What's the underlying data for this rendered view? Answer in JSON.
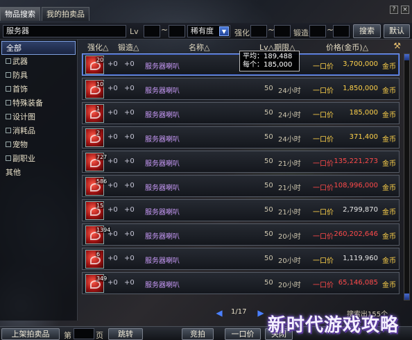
{
  "tabs": [
    {
      "label": "物品搜索"
    },
    {
      "label": "我的拍卖品"
    }
  ],
  "search": {
    "query": "服务器",
    "lv_label": "Lv",
    "tilde": "~",
    "rarity_label": "稀有度",
    "enhance_label": "强化",
    "forge_label": "锻造",
    "search_button": "搜索",
    "default_button": "默认"
  },
  "categories": [
    {
      "label": "全部",
      "selected": true,
      "expandable": false
    },
    {
      "label": "武器",
      "selected": false,
      "expandable": true
    },
    {
      "label": "防具",
      "selected": false,
      "expandable": true
    },
    {
      "label": "首饰",
      "selected": false,
      "expandable": true
    },
    {
      "label": "特殊装备",
      "selected": false,
      "expandable": true
    },
    {
      "label": "设计图",
      "selected": false,
      "expandable": true
    },
    {
      "label": "消耗品",
      "selected": false,
      "expandable": true
    },
    {
      "label": "宠物",
      "selected": false,
      "expandable": true
    },
    {
      "label": "副职业",
      "selected": false,
      "expandable": true
    },
    {
      "label": "其他",
      "selected": false,
      "expandable": false
    }
  ],
  "columns": {
    "enhance": "强化△",
    "forge": "锻造△",
    "name": "名称△",
    "lv_time": "Lv△期限△",
    "price": "价格(金币)△"
  },
  "tooltip": {
    "line1": "平均：189,488",
    "line2": "每个：185,000"
  },
  "rows": [
    {
      "qty": "20",
      "enhance": "+0",
      "forge": "+0",
      "name": "服务器喇叭",
      "lv": "50",
      "time": "",
      "price_type": "一口价",
      "price": "3,700,000",
      "price_color": "gold",
      "currency": "金币"
    },
    {
      "qty": "10",
      "enhance": "+0",
      "forge": "+0",
      "name": "服务器喇叭",
      "lv": "50",
      "time": "24小时",
      "price_type": "一口价",
      "price": "1,850,000",
      "price_color": "gold",
      "currency": "金币"
    },
    {
      "qty": "1",
      "enhance": "+0",
      "forge": "+0",
      "name": "服务器喇叭",
      "lv": "50",
      "time": "24小时",
      "price_type": "一口价",
      "price": "185,000",
      "price_color": "gold",
      "currency": "金币"
    },
    {
      "qty": "2",
      "enhance": "+0",
      "forge": "+0",
      "name": "服务器喇叭",
      "lv": "50",
      "time": "24小时",
      "price_type": "一口价",
      "price": "371,400",
      "price_color": "gold",
      "currency": "金币"
    },
    {
      "qty": "727",
      "enhance": "+0",
      "forge": "+0",
      "name": "服务器喇叭",
      "lv": "50",
      "time": "21小时",
      "price_type": "一口价",
      "price": "135,221,273",
      "price_color": "red",
      "currency": "金币"
    },
    {
      "qty": "586",
      "enhance": "+0",
      "forge": "+0",
      "name": "服务器喇叭",
      "lv": "50",
      "time": "21小时",
      "price_type": "一口价",
      "price": "108,996,000",
      "price_color": "red",
      "currency": "金币"
    },
    {
      "qty": "15",
      "enhance": "+0",
      "forge": "+0",
      "name": "服务器喇叭",
      "lv": "50",
      "time": "21小时",
      "price_type": "一口价",
      "price": "2,799,870",
      "price_color": "white",
      "currency": "金币"
    },
    {
      "qty": "1394",
      "enhance": "+0",
      "forge": "+0",
      "name": "服务器喇叭",
      "lv": "50",
      "time": "20小时",
      "price_type": "一口价",
      "price": "260,202,646",
      "price_color": "red",
      "currency": "金币"
    },
    {
      "qty": "6",
      "enhance": "+0",
      "forge": "+0",
      "name": "服务器喇叭",
      "lv": "50",
      "time": "20小时",
      "price_type": "一口价",
      "price": "1,119,960",
      "price_color": "white",
      "currency": "金币"
    },
    {
      "qty": "349",
      "enhance": "+0",
      "forge": "+0",
      "name": "服务器喇叭",
      "lv": "50",
      "time": "20小时",
      "price_type": "一口价",
      "price": "65,146,085",
      "price_color": "red",
      "currency": "金币"
    }
  ],
  "pager": {
    "text": "1/17"
  },
  "total_text": "搜索出155个",
  "bottom": {
    "list_button": "上架拍卖品",
    "page_label_prefix": "第",
    "page_label_suffix": "页",
    "jump_button": "跳转",
    "bid_button": "竞拍",
    "buyout_button": "一口价",
    "close_button": "关闭"
  },
  "watermark": "新时代游戏攻略",
  "colors": {
    "gold": "#ffd24a",
    "red": "#ff4a4a",
    "name_purple": "#c89af8",
    "accent_blue": "#7fa6ff"
  }
}
